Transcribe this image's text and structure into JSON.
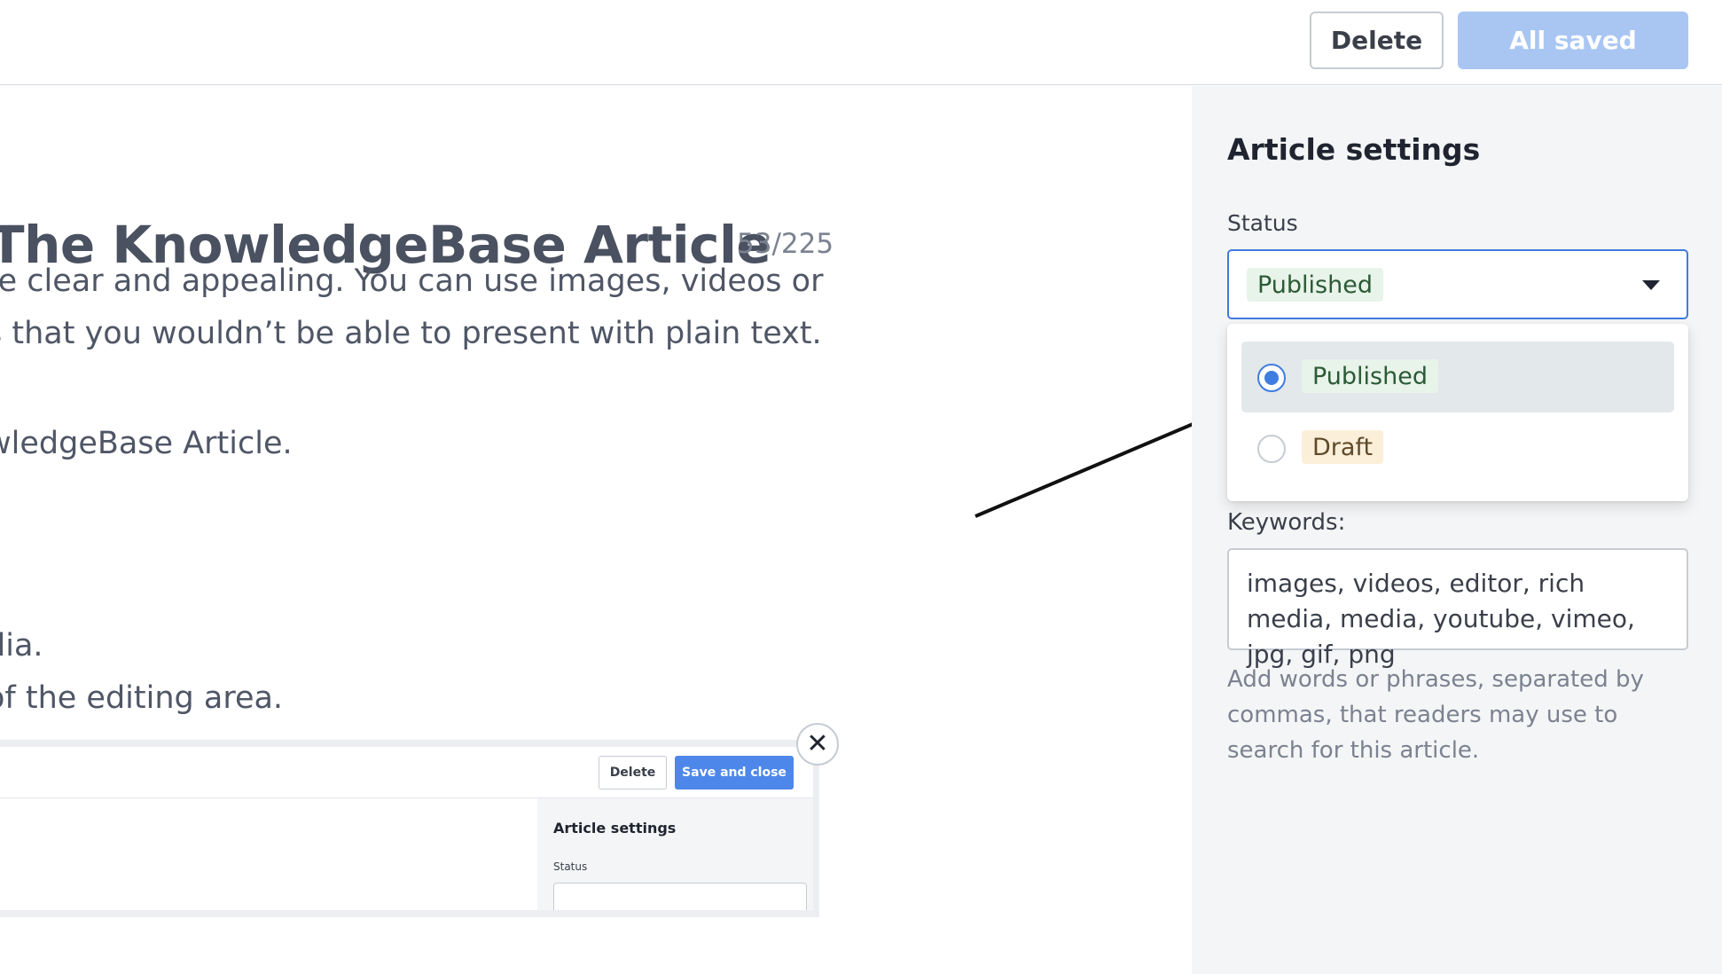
{
  "toolbar": {
    "delete_label": "Delete",
    "saved_label": "All saved"
  },
  "editor": {
    "title": "The KnowledgeBase Article",
    "char_counter": "53/225",
    "paragraphs": [
      "re clear and appealing. You can use images, videos or",
      "s that you wouldn’t be able to present with plain text.",
      "wledgeBase Article.",
      "dia.",
      " of the editing area."
    ]
  },
  "nested_screenshot": {
    "delete_label": "Delete",
    "save_label": "Save and close",
    "settings_title": "Article settings",
    "status_label": "Status",
    "close_icon": "close-icon"
  },
  "sidebar": {
    "title": "Article settings",
    "status_label": "Status",
    "status_selected": "Published",
    "options": [
      {
        "label": "Published",
        "checked": true
      },
      {
        "label": "Draft",
        "checked": false
      }
    ],
    "keywords_label": "Keywords:",
    "keywords_value": "images, videos, editor, rich media, media, youtube, vimeo, jpg, gif, png",
    "keywords_help": "Add words or phrases, separated by commas, that readers may use to search for this article."
  },
  "colors": {
    "accent": "#3f7ce0",
    "saved_button": "#a9c6f3",
    "published_pill": "#e8f3ea",
    "draft_pill": "#fbefd9",
    "sidebar_bg": "#f4f5f6"
  }
}
